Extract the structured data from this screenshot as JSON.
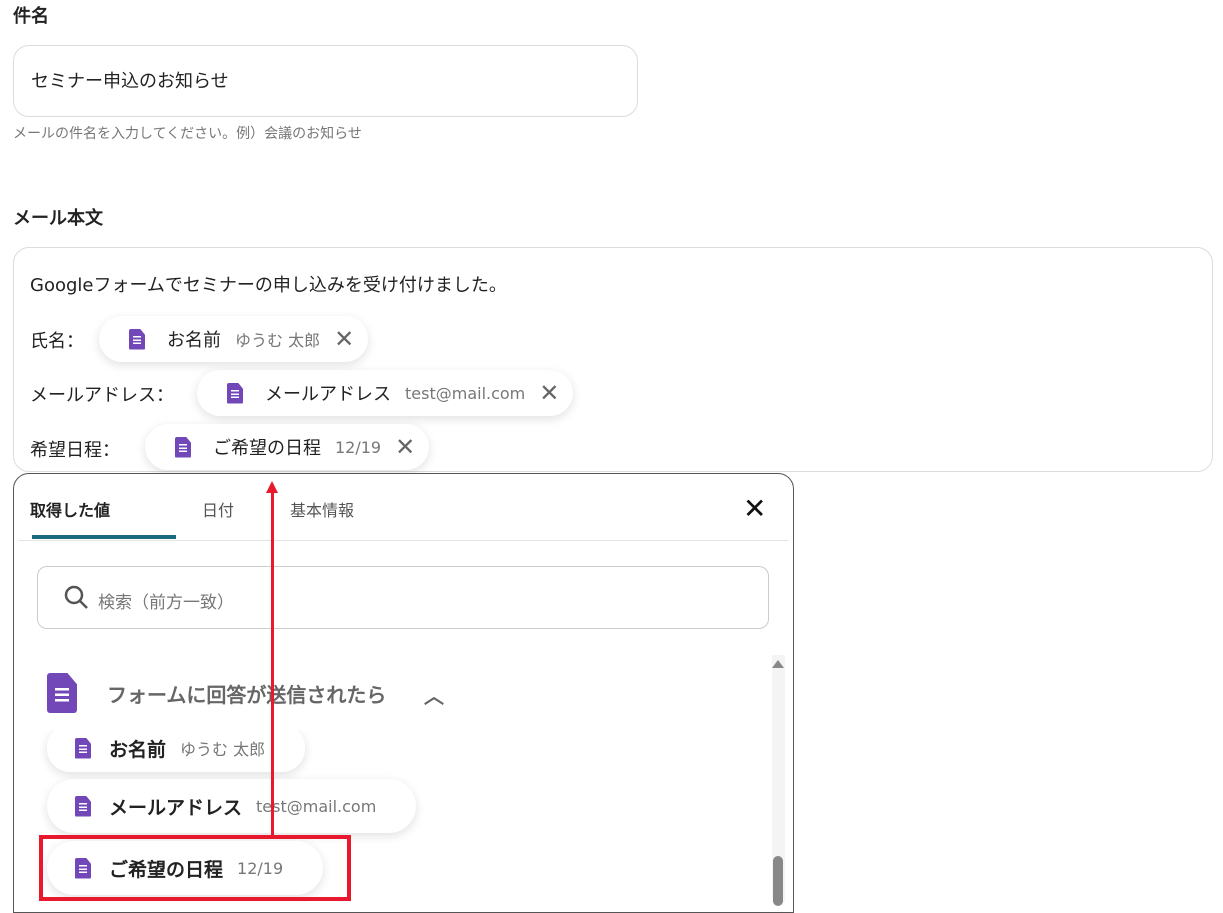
{
  "subject": {
    "label": "件名",
    "value": "セミナー申込のお知らせ",
    "help": "メールの件名を入力してください。例）会議のお知らせ"
  },
  "body": {
    "label": "メール本文",
    "line1": "Googleフォームでセミナーの申し込みを受け付けました。",
    "rows": [
      {
        "label": "氏名：",
        "chip_name": "お名前",
        "chip_value": "ゆうむ 太郎"
      },
      {
        "label": "メールアドレス：",
        "chip_name": "メールアドレス",
        "chip_value": "test@mail.com"
      },
      {
        "label": "希望日程：",
        "chip_name": "ご希望の日程",
        "chip_value": "12/19"
      }
    ]
  },
  "popup": {
    "tabs": [
      "取得した値",
      "日付",
      "基本情報"
    ],
    "active_tab": "取得した値",
    "search_placeholder": "検索（前方一致）",
    "section_title": "フォームに回答が送信されたら",
    "items": [
      {
        "name": "お名前",
        "value": "ゆうむ 太郎"
      },
      {
        "name": "メールアドレス",
        "value": "test@mail.com"
      },
      {
        "name": "ご希望の日程",
        "value": "12/19"
      }
    ]
  },
  "colors": {
    "accent": "#1a6b80",
    "form_icon": "#7248b9",
    "highlight": "#e8192c"
  }
}
